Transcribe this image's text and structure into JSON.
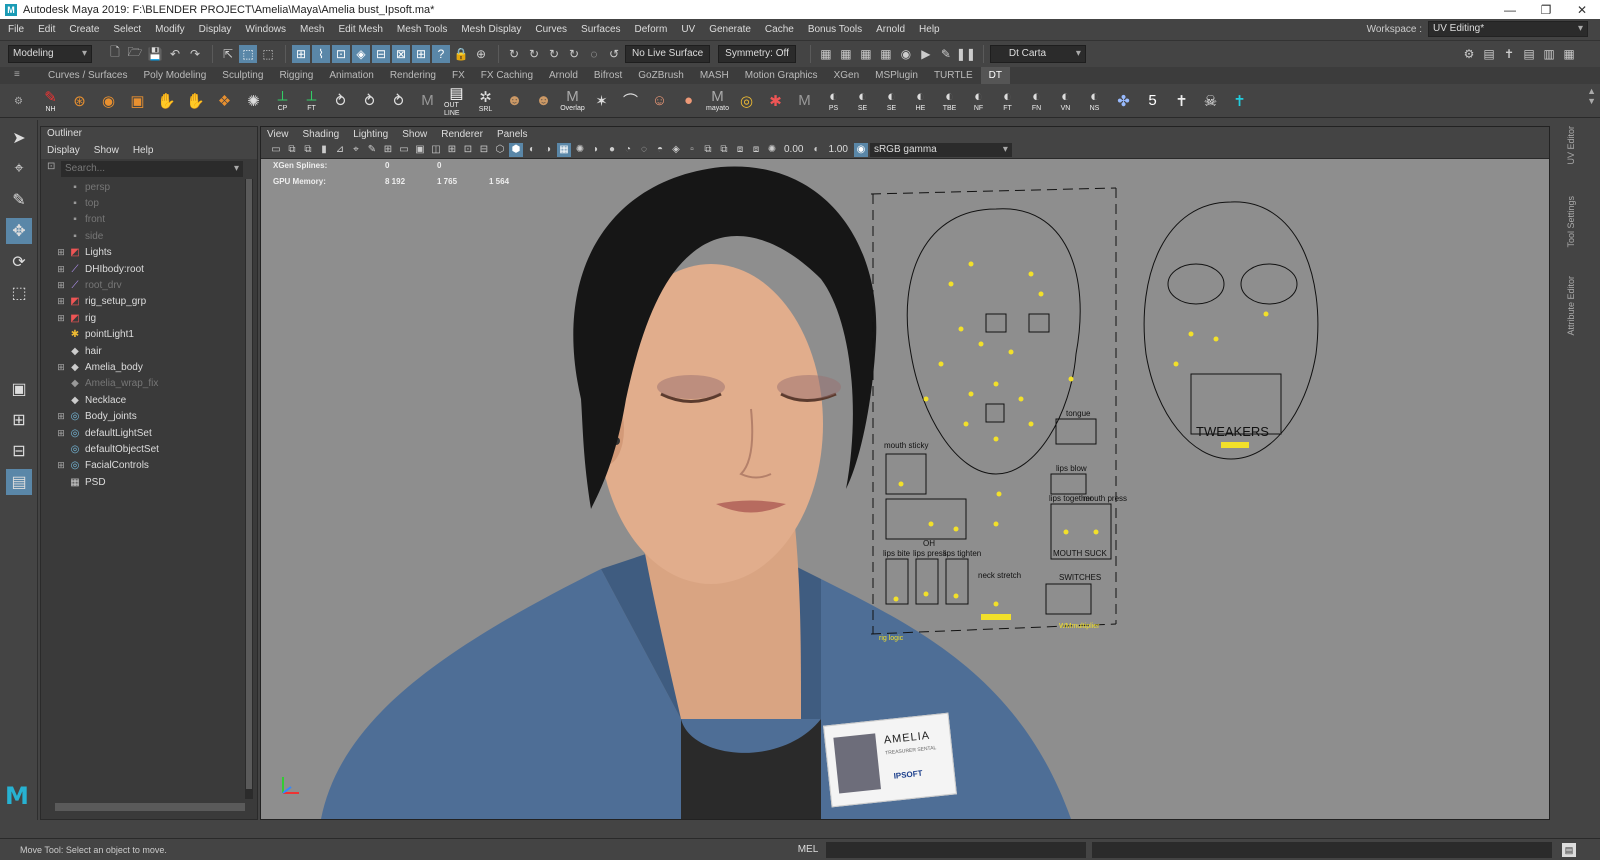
{
  "window": {
    "title": "Autodesk Maya 2019: F:\\BLENDER PROJECT\\Amelia\\Maya\\Amelia bust_Ipsoft.ma*",
    "minimize": "—",
    "maximize": "❐",
    "close": "✕"
  },
  "menubar": {
    "items": [
      "File",
      "Edit",
      "Create",
      "Select",
      "Modify",
      "Display",
      "Windows",
      "Mesh",
      "Edit Mesh",
      "Mesh Tools",
      "Mesh Display",
      "Curves",
      "Surfaces",
      "Deform",
      "UV",
      "Generate",
      "Cache",
      "Bonus Tools",
      "Arnold",
      "Help"
    ],
    "workspace_label": "Workspace :",
    "workspace_value": "UV Editing*"
  },
  "statusline": {
    "mode": "Modeling",
    "live_surface": "No Live Surface",
    "symmetry": "Symmetry: Off",
    "camera": "Dt Carta"
  },
  "shelf": {
    "tabs": [
      "Curves / Surfaces",
      "Poly Modeling",
      "Sculpting",
      "Rigging",
      "Animation",
      "Rendering",
      "FX",
      "FX Caching",
      "Arnold",
      "Bifrost",
      "GoZBrush",
      "MASH",
      "Motion Graphics",
      "XGen",
      "MSPlugin",
      "TURTLE",
      "DT"
    ],
    "active_tab": "DT",
    "icons": [
      {
        "name": "nh-icon",
        "glyph": "✎",
        "label": "NH",
        "color": "#e33"
      },
      {
        "name": "soccer-ball-icon",
        "glyph": "⊛",
        "label": "",
        "color": "#e89030"
      },
      {
        "name": "layers-icon",
        "glyph": "◉",
        "label": "",
        "color": "#e89030"
      },
      {
        "name": "blocks-icon",
        "glyph": "▣",
        "label": "",
        "color": "#e89030"
      },
      {
        "name": "hand-icon",
        "glyph": "✋",
        "label": "",
        "color": "#e89030"
      },
      {
        "name": "hand2-icon",
        "glyph": "✋",
        "label": "",
        "color": "#e89030"
      },
      {
        "name": "stack-icon",
        "glyph": "❖",
        "label": "",
        "color": "#e89030"
      },
      {
        "name": "sphere-icon",
        "glyph": "✺",
        "label": "",
        "color": "#ddd"
      },
      {
        "name": "cp-icon",
        "glyph": "⟂",
        "label": "CP",
        "color": "#3c6"
      },
      {
        "name": "ft-icon",
        "glyph": "⟂",
        "label": "FT",
        "color": "#3c6"
      },
      {
        "name": "joint-icon",
        "glyph": "⥁",
        "label": "",
        "color": "#ddd"
      },
      {
        "name": "joint2-icon",
        "glyph": "⥁",
        "label": "",
        "color": "#ddd"
      },
      {
        "name": "joint3-icon",
        "glyph": "⥁",
        "label": "",
        "color": "#ddd"
      },
      {
        "name": "maya-m-icon",
        "glyph": "M",
        "label": "",
        "color": "#999"
      },
      {
        "name": "outline-icon",
        "glyph": "▤",
        "label": "OUT LINE",
        "color": "#fff"
      },
      {
        "name": "srl-icon",
        "glyph": "✲",
        "label": "SRL",
        "color": "#ddd"
      },
      {
        "name": "anime-icon",
        "glyph": "☻",
        "label": "",
        "color": "#c96"
      },
      {
        "name": "anime2-icon",
        "glyph": "☻",
        "label": "",
        "color": "#c96"
      },
      {
        "name": "overlap-icon",
        "glyph": "M",
        "label": "Overlap",
        "color": "#aaa"
      },
      {
        "name": "rig-icon",
        "glyph": "✶",
        "label": "",
        "color": "#ddd"
      },
      {
        "name": "curve-icon",
        "glyph": "⌒",
        "label": "",
        "color": "#ddd"
      },
      {
        "name": "face-icon",
        "glyph": "☺",
        "label": "",
        "color": "#e97"
      },
      {
        "name": "head-icon",
        "glyph": "●",
        "label": "",
        "color": "#e97"
      },
      {
        "name": "mayato-icon",
        "glyph": "M",
        "label": "mayato",
        "color": "#aaa"
      },
      {
        "name": "spiral-icon",
        "glyph": "◎",
        "label": "",
        "color": "#eb3"
      },
      {
        "name": "person-icon",
        "glyph": "✱",
        "label": "",
        "color": "#e55"
      },
      {
        "name": "maya-m2-icon",
        "glyph": "M",
        "label": "",
        "color": "#999"
      },
      {
        "name": "ps-icon",
        "glyph": "◐",
        "label": "PS",
        "color": "#ddd"
      },
      {
        "name": "se-icon",
        "glyph": "◐",
        "label": "SE",
        "color": "#ddd"
      },
      {
        "name": "se2-icon",
        "glyph": "◐",
        "label": "SE",
        "color": "#ddd"
      },
      {
        "name": "he-icon",
        "glyph": "◐",
        "label": "HE",
        "color": "#ddd"
      },
      {
        "name": "tbe-icon",
        "glyph": "◐",
        "label": "TBE",
        "color": "#ddd"
      },
      {
        "name": "nf-icon",
        "glyph": "◐",
        "label": "NF",
        "color": "#ddd"
      },
      {
        "name": "ft2-icon",
        "glyph": "◐",
        "label": "FT",
        "color": "#ddd"
      },
      {
        "name": "fn-icon",
        "glyph": "◐",
        "label": "FN",
        "color": "#ddd"
      },
      {
        "name": "vn-icon",
        "glyph": "◐",
        "label": "VN",
        "color": "#ddd"
      },
      {
        "name": "ns-icon",
        "glyph": "◐",
        "label": "NS",
        "color": "#ddd"
      },
      {
        "name": "molecule-icon",
        "glyph": "✤",
        "label": "",
        "color": "#9bf"
      },
      {
        "name": "five-icon",
        "glyph": "5",
        "label": "",
        "color": "#fff"
      },
      {
        "name": "t-pose-icon",
        "glyph": "✝",
        "label": "",
        "color": "#eee"
      },
      {
        "name": "skull-icon",
        "glyph": "☠",
        "label": "",
        "color": "#eee"
      },
      {
        "name": "t-pose-cyan-icon",
        "glyph": "✝",
        "label": "",
        "color": "#2cd"
      }
    ]
  },
  "outliner": {
    "title": "Outliner",
    "menu": [
      "Display",
      "Show",
      "Help"
    ],
    "search_placeholder": "Search...",
    "items": [
      {
        "label": "persp",
        "icon": "camera-icon",
        "glyph": "▪",
        "expand": "",
        "dim": true,
        "color": "#999"
      },
      {
        "label": "top",
        "icon": "camera-icon",
        "glyph": "▪",
        "expand": "",
        "dim": true,
        "color": "#999"
      },
      {
        "label": "front",
        "icon": "camera-icon",
        "glyph": "▪",
        "expand": "",
        "dim": true,
        "color": "#999"
      },
      {
        "label": "side",
        "icon": "camera-icon",
        "glyph": "▪",
        "expand": "",
        "dim": true,
        "color": "#999"
      },
      {
        "label": "Lights",
        "icon": "group-icon",
        "glyph": "◩",
        "expand": "⊞",
        "dim": false,
        "color": "#e55"
      },
      {
        "label": "DHIbody:root",
        "icon": "joint-icon",
        "glyph": "⟋",
        "expand": "⊞",
        "dim": false,
        "color": "#b9f"
      },
      {
        "label": "root_drv",
        "icon": "joint-icon",
        "glyph": "⟋",
        "expand": "⊞",
        "dim": true,
        "color": "#b9f"
      },
      {
        "label": "rig_setup_grp",
        "icon": "group-icon",
        "glyph": "◩",
        "expand": "⊞",
        "dim": false,
        "color": "#e55"
      },
      {
        "label": "rig",
        "icon": "group-icon",
        "glyph": "◩",
        "expand": "⊞",
        "dim": false,
        "color": "#e55"
      },
      {
        "label": "pointLight1",
        "icon": "light-icon",
        "glyph": "✱",
        "expand": "",
        "dim": false,
        "color": "#eb3"
      },
      {
        "label": "hair",
        "icon": "mesh-icon",
        "glyph": "◆",
        "expand": "",
        "dim": false,
        "color": "#ccc"
      },
      {
        "label": "Amelia_body",
        "icon": "mesh-icon",
        "glyph": "◆",
        "expand": "⊞",
        "dim": false,
        "color": "#ccc"
      },
      {
        "label": "Amelia_wrap_fix",
        "icon": "mesh-icon",
        "glyph": "◆",
        "expand": "",
        "dim": true,
        "color": "#999"
      },
      {
        "label": "Necklace",
        "icon": "mesh-icon",
        "glyph": "◆",
        "expand": "",
        "dim": false,
        "color": "#ccc"
      },
      {
        "label": "Body_joints",
        "icon": "set-icon",
        "glyph": "◎",
        "expand": "⊞",
        "dim": false,
        "color": "#7bd"
      },
      {
        "label": "defaultLightSet",
        "icon": "set-icon",
        "glyph": "◎",
        "expand": "⊞",
        "dim": false,
        "color": "#7bd"
      },
      {
        "label": "defaultObjectSet",
        "icon": "set-icon",
        "glyph": "◎",
        "expand": "",
        "dim": false,
        "color": "#7bd"
      },
      {
        "label": "FacialControls",
        "icon": "set-icon",
        "glyph": "◎",
        "expand": "⊞",
        "dim": false,
        "color": "#7bd"
      },
      {
        "label": "PSD",
        "icon": "psd-icon",
        "glyph": "▦",
        "expand": "",
        "dim": false,
        "color": "#ccc"
      }
    ]
  },
  "viewport": {
    "menu": [
      "View",
      "Shading",
      "Lighting",
      "Show",
      "Renderer",
      "Panels"
    ],
    "exposure": "0.00",
    "gamma": "1.00",
    "color_space": "sRGB gamma",
    "hud": [
      {
        "label": "XGen Splines:",
        "v1": "0",
        "v2": "0",
        "v3": ""
      },
      {
        "label": "GPU Memory:",
        "v1": "8 192",
        "v2": "1 765",
        "v3": "1 564"
      }
    ],
    "rig_panel": {
      "labels": [
        "mouth sticky",
        "lips bite",
        "lips press",
        "lips tighten",
        "OH",
        "neck stretch",
        "lips together",
        "mouth press",
        "MOUTH SUCK",
        "SWITCHES",
        "tongue",
        "lips blow",
        "rig logic",
        "WMmultiplier"
      ],
      "tweakers": "TWEAKERS"
    },
    "badge": {
      "name": "AMELIA",
      "sub": "TREASURER SENTAL",
      "brand": "IPSOFT"
    }
  },
  "right_dock": {
    "tabs": [
      "UV Editor",
      "Tool Settings",
      "Attribute Editor"
    ]
  },
  "statusbar": {
    "help": "Move Tool: Select an object to move.",
    "mel": "MEL"
  },
  "colors": {
    "accent": "#5a87a8",
    "panel": "#444444",
    "viewport_bg": "#8e8e8e",
    "rig_yellow": "#f2e02a"
  }
}
